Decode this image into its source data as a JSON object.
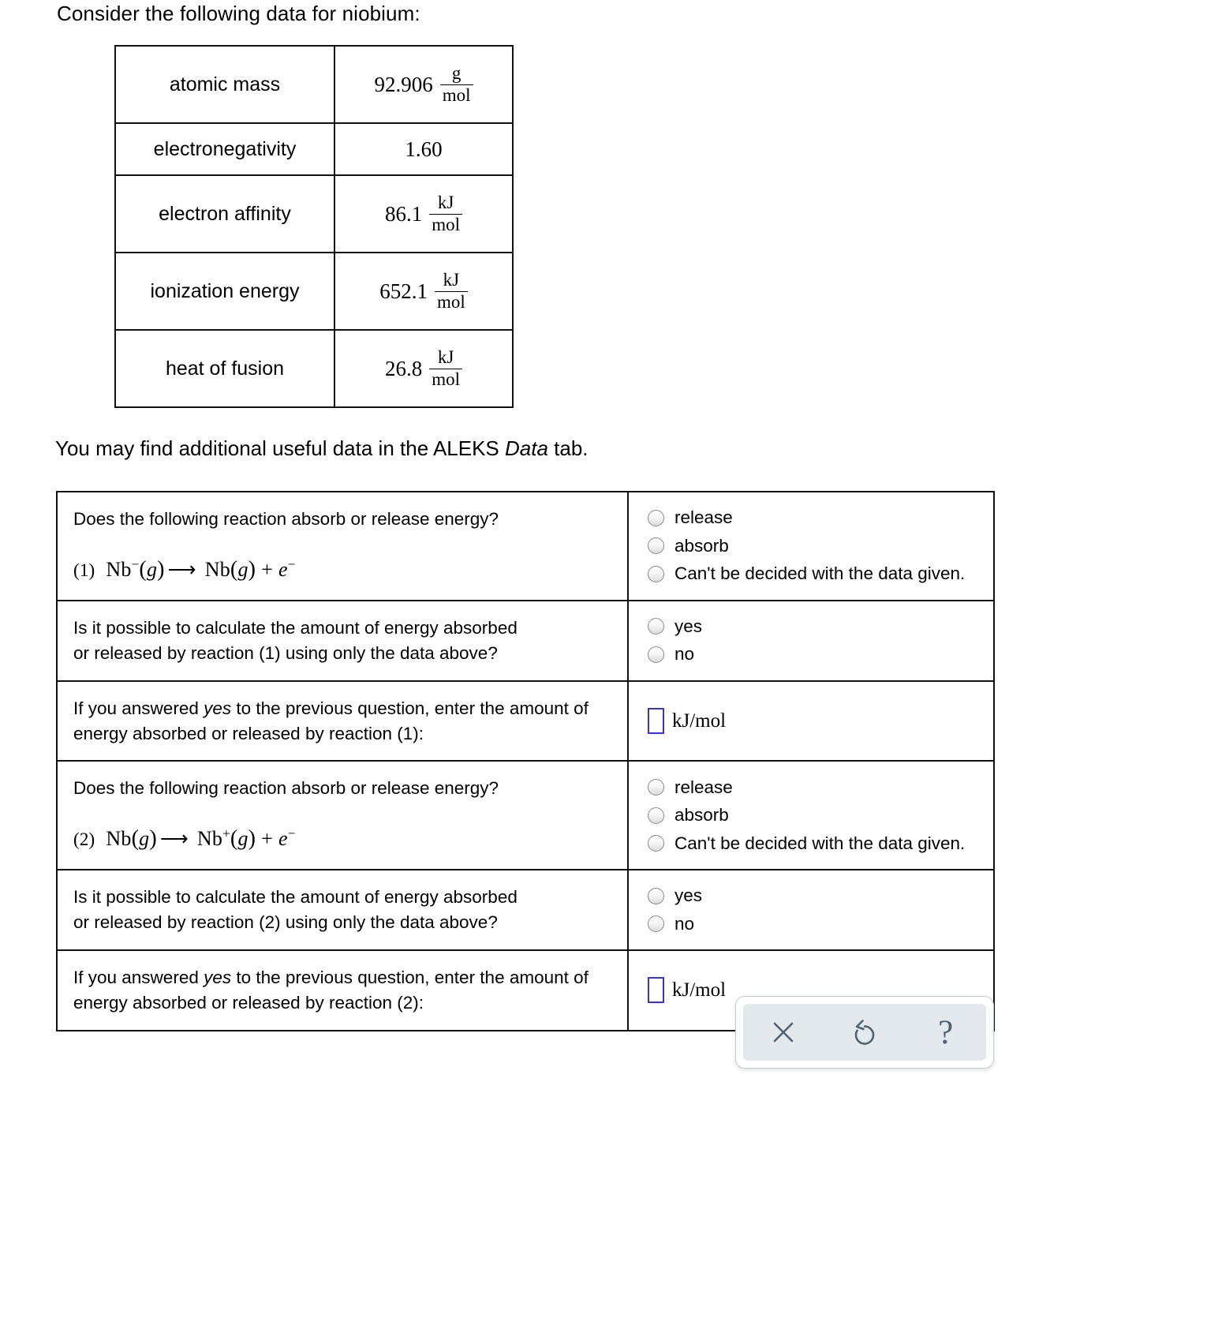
{
  "intro": "Consider the following data for niobium:",
  "data_table": {
    "rows": [
      {
        "label": "atomic mass",
        "value": "92.906",
        "unit_num": "g",
        "unit_den": "mol",
        "has_fraction": true
      },
      {
        "label": "electronegativity",
        "value": "1.60",
        "unit_num": "",
        "unit_den": "",
        "has_fraction": false
      },
      {
        "label": "electron affinity",
        "value": "86.1",
        "unit_num": "kJ",
        "unit_den": "mol",
        "has_fraction": true
      },
      {
        "label": "ionization energy",
        "value": "652.1",
        "unit_num": "kJ",
        "unit_den": "mol",
        "has_fraction": true
      },
      {
        "label": "heat of fusion",
        "value": "26.8",
        "unit_num": "kJ",
        "unit_den": "mol",
        "has_fraction": true
      }
    ]
  },
  "aleks_note": {
    "before": "You may find additional useful data in the ALEKS ",
    "italic": "Data",
    "after": " tab."
  },
  "questions": {
    "q1": {
      "prompt": "Does the following reaction absorb or release energy?",
      "reaction": {
        "index": "(1)",
        "reactant_symbol": "Nb",
        "reactant_charge": "−",
        "reactant_state": "g",
        "arrow": "⟶",
        "product_symbol": "Nb",
        "product_charge": "",
        "product_state": "g",
        "plus": "+",
        "electron": "e",
        "electron_charge": "−"
      },
      "options": [
        "release",
        "absorb",
        "Can't be decided with the data given."
      ]
    },
    "q2": {
      "prompt_line1": "Is it possible to calculate the amount of energy absorbed",
      "prompt_line2": "or released by reaction (1) using only the data above?",
      "options": [
        "yes",
        "no"
      ]
    },
    "q3": {
      "prompt_part1": "If you answered ",
      "prompt_italic": "yes",
      "prompt_part2": " to the previous question, enter the amount of energy absorbed or released by reaction (1):",
      "input_value": "",
      "unit": "kJ/mol"
    },
    "q4": {
      "prompt": "Does the following reaction absorb or release energy?",
      "reaction": {
        "index": "(2)",
        "reactant_symbol": "Nb",
        "reactant_charge": "",
        "reactant_state": "g",
        "arrow": "⟶",
        "product_symbol": "Nb",
        "product_charge": "+",
        "product_state": "g",
        "plus": "+",
        "electron": "e",
        "electron_charge": "−"
      },
      "options": [
        "release",
        "absorb",
        "Can't be decided with the data given."
      ]
    },
    "q5": {
      "prompt_line1": "Is it possible to calculate the amount of energy absorbed",
      "prompt_line2": "or released by reaction (2) using only the data above?",
      "options": [
        "yes",
        "no"
      ]
    },
    "q6": {
      "prompt_part1": "If you answered ",
      "prompt_italic": "yes",
      "prompt_part2": " to the previous question, enter the amount of energy absorbed or released by reaction (2):",
      "input_value": "",
      "unit": "kJ/mol"
    }
  },
  "toolbar": {
    "buttons": [
      {
        "name": "clear-button",
        "icon": "close-icon"
      },
      {
        "name": "reset-button",
        "icon": "undo-icon"
      },
      {
        "name": "help-button",
        "icon": "question-mark-icon",
        "glyph": "?"
      }
    ]
  },
  "colors": {
    "input_border": "#3b34cf",
    "toolbar_bg": "#e3e9ec",
    "toolbar_icon": "#4f6470",
    "table_border": "#111111"
  }
}
